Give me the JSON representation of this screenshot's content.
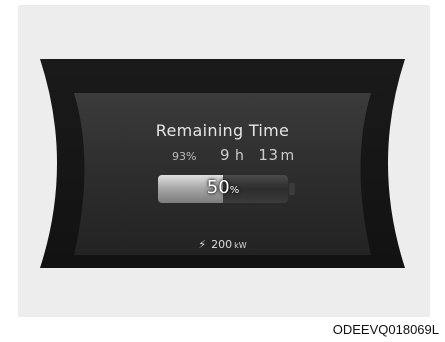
{
  "cluster": {
    "title": "Remaining Time",
    "state_of_charge": "93%",
    "time_hours": "9",
    "time_hours_unit": "h",
    "time_minutes": "13",
    "time_minutes_unit": "m",
    "battery_level_value": "50",
    "battery_level_unit": "%",
    "battery_fill_fraction": 0.5,
    "charge_icon": "lightning-bolt-icon",
    "charge_power_value": "200",
    "charge_power_unit": "kW"
  },
  "image_code": "ODEEVQ018069L",
  "colors": {
    "frame": "#ededed",
    "display_black": "#151515",
    "display_panel": "#2a2a2a",
    "text": "#d9d9d9"
  }
}
